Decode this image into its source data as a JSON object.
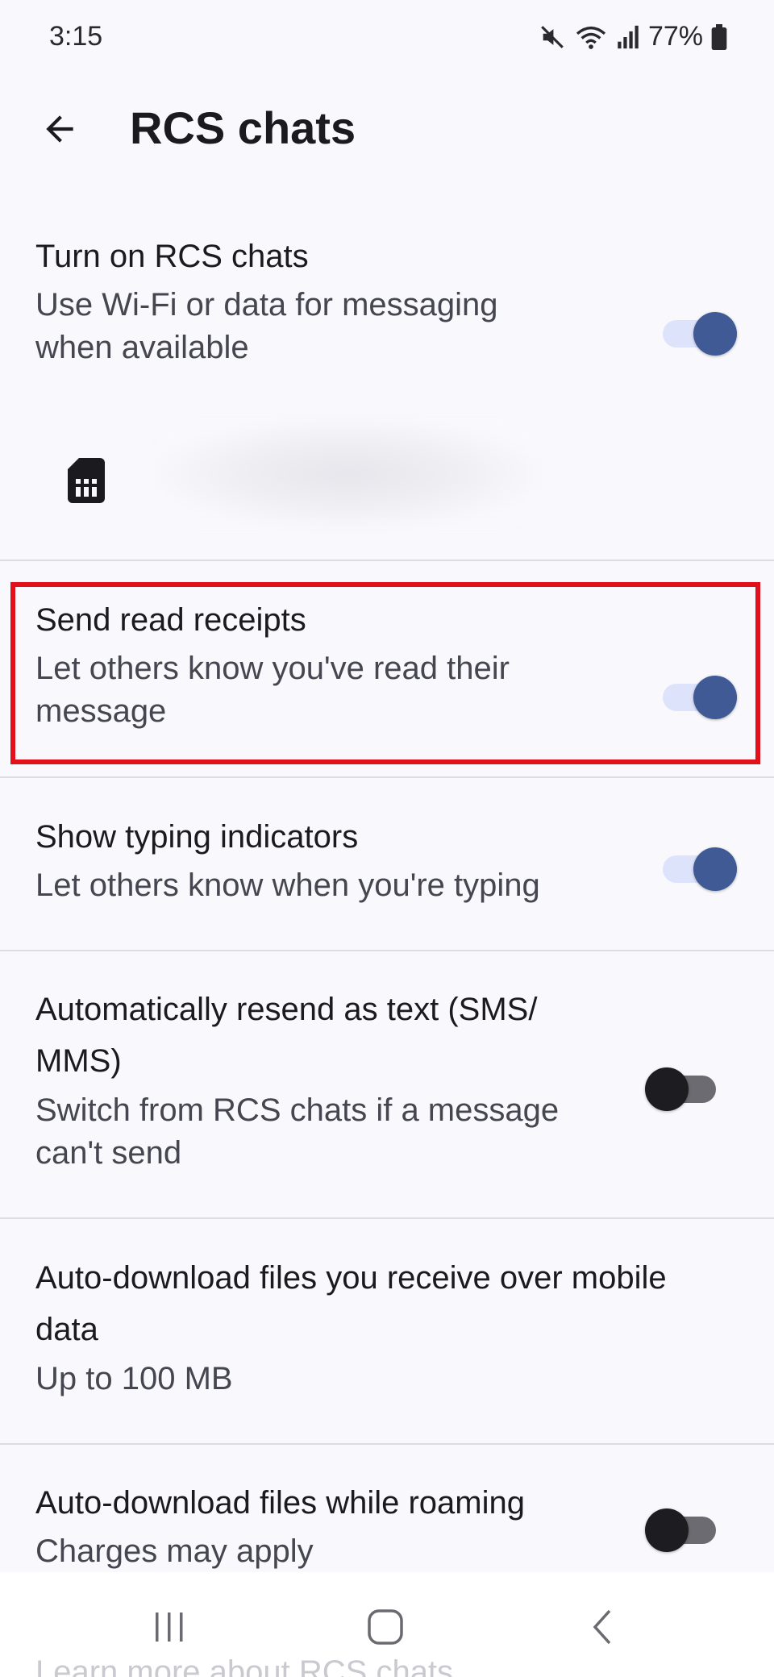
{
  "status_bar": {
    "time": "3:15",
    "battery": "77%",
    "icons": [
      "mute-icon",
      "wifi-icon",
      "signal-icon",
      "battery-icon"
    ]
  },
  "app_bar": {
    "title": "RCS chats",
    "back_icon": "arrow-back-icon"
  },
  "settings": [
    {
      "title": "Turn on RCS chats",
      "summary": "Use Wi-Fi or data for messaging\nwhen available",
      "toggle": "on"
    },
    {
      "title": "Send read receipts",
      "summary": "Let others know you've read their\nmessage",
      "toggle": "on"
    },
    {
      "title": "Show typing indicators",
      "summary": "Let others know when you're typing",
      "toggle": "on"
    },
    {
      "title": "Automatically resend as text (SMS/\nMMS)",
      "summary": "Switch from RCS chats if a message\ncan't send",
      "toggle": "off"
    },
    {
      "title": "Auto-download files you receive over mobile\ndata",
      "summary": "Up to 100 MB"
    },
    {
      "title": "Auto-download files while roaming",
      "summary": "Charges may apply",
      "toggle": "off"
    }
  ],
  "sim": {
    "icon": "sim-card-icon"
  },
  "footer_peek": "Learn more about RCS chats",
  "colors": {
    "background": "#f8f8fd",
    "toggle_on": "#3f5a94",
    "toggle_on_track": "#dde3fb",
    "toggle_off_thumb": "#1d1c20",
    "highlight": "#e2101a"
  },
  "nav": {
    "icons": [
      "recent-apps-icon",
      "home-icon",
      "back-nav-icon"
    ]
  }
}
